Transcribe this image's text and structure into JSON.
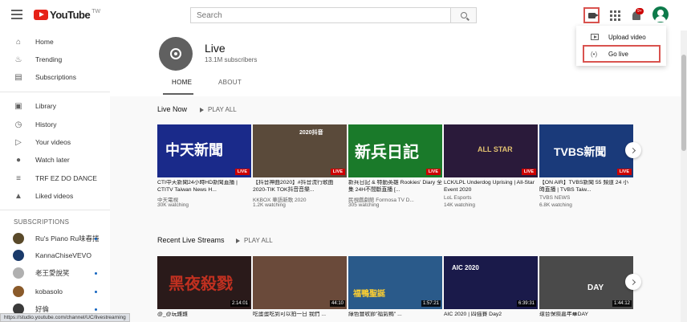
{
  "header": {
    "logo_text": "YouTube",
    "logo_region": "TW",
    "search_placeholder": "Search"
  },
  "notifications": {
    "badge": "9+"
  },
  "sidebar": {
    "main_items": [
      {
        "label": "Home",
        "icon": "home-icon"
      },
      {
        "label": "Trending",
        "icon": "flame-icon"
      },
      {
        "label": "Subscriptions",
        "icon": "subscriptions-icon"
      }
    ],
    "library_items": [
      {
        "label": "Library",
        "icon": "library-icon"
      },
      {
        "label": "History",
        "icon": "history-icon"
      },
      {
        "label": "Your videos",
        "icon": "your-videos-icon"
      },
      {
        "label": "Watch later",
        "icon": "clock-icon"
      },
      {
        "label": "TRF EZ DO DANCE",
        "icon": "playlist-icon"
      },
      {
        "label": "Liked videos",
        "icon": "thumbs-up-icon"
      }
    ],
    "subscriptions_header": "SUBSCRIPTIONS",
    "subscriptions": [
      {
        "name": "Ru's Piano Ru味春捲",
        "color": "#5a4a2a",
        "dot": true
      },
      {
        "name": "KannaChiseVEVO",
        "color": "#1a3a6a",
        "dot": false
      },
      {
        "name": "老王愛說笑",
        "color": "#b0b0b0",
        "dot": true
      },
      {
        "name": "kobasolo",
        "color": "#8a5a2a",
        "dot": true
      },
      {
        "name": "好倫",
        "color": "#3a3a3a",
        "dot": true
      }
    ]
  },
  "channel": {
    "name": "Live",
    "subscribers": "13.1M subscribers",
    "tabs": [
      "HOME",
      "ABOUT"
    ]
  },
  "sections": {
    "live_now": {
      "title": "Live Now",
      "play_all": "PLAY ALL",
      "cards": [
        {
          "title": "CTI中天新聞24小時HD新聞直播 | CTITV Taiwan News H...",
          "channel": "中天電視",
          "meta": "30K watching",
          "tag": "LIVE",
          "bg": "#1a2a8a",
          "thumb_text": "中天新聞",
          "thumb_color": "#ffffff"
        },
        {
          "title": "【抖音神曲2020】#抖音流行歌曲 2020-TIK TOK抖音音樂...",
          "channel": "KKBOX 華語新歌 2020",
          "meta": "1.2K watching",
          "tag": "LIVE",
          "bg": "#5a4a3a",
          "thumb_text": "2020抖音",
          "thumb_color": "#ffffff"
        },
        {
          "title": "新兵日記 & 特勤英雄 Rookies' Diary 全集 24H不間斷直播 [...",
          "channel": "民視戲劇館 Formosa TV D...",
          "meta": "305 watching",
          "tag": "LIVE",
          "bg": "#1a7a2a",
          "thumb_text": "新兵日記",
          "thumb_color": "#ffffff"
        },
        {
          "title": "LCK/LPL Underdog Uprising | All-Star Event 2020",
          "channel": "LoL Esports",
          "meta": "14K watching",
          "tag": "LIVE",
          "bg": "#2a1a3a",
          "thumb_text": "ALL STAR",
          "thumb_color": "#e0c070"
        },
        {
          "title": "【ON AIR】TVBS新聞 55 頻道 24 小時直播 | TVBS Taiw...",
          "channel": "TVBS NEWS",
          "meta": "6.8K watching",
          "tag": "LIVE",
          "bg": "#1a3a7a",
          "thumb_text": "TVBS新聞",
          "thumb_color": "#ffffff"
        }
      ]
    },
    "recent_live": {
      "title": "Recent Live Streams",
      "play_all": "PLAY ALL",
      "cards": [
        {
          "title": "@_@玩雞雞",
          "duration": "2:14:01",
          "bg": "#2a1a1a",
          "thumb_text": "黑夜殺戮",
          "thumb_color": "#c03020"
        },
        {
          "title": "吃蛋蛋吃到可以拍一日 我們 ...",
          "duration": "44:10",
          "bg": "#6a4a3a",
          "thumb_text": "",
          "thumb_color": "#ffffff"
        },
        {
          "title": "綠色豐收節\"福氣鴨\" ...",
          "duration": "1:57:21",
          "bg": "#2a5a8a",
          "thumb_text": "福鴨聖誕",
          "thumb_color": "#ffd030"
        },
        {
          "title": "AIC 2020 | 四強賽 Day2",
          "duration": "6:39:31",
          "bg": "#1a1a4a",
          "thumb_text": "AIC 2020",
          "thumb_color": "#ffffff"
        },
        {
          "title": "環台保險嘉年華DAY",
          "duration": "1:44:12",
          "bg": "#4a4a4a",
          "thumb_text": "DAY",
          "thumb_color": "#ffffff"
        }
      ]
    }
  },
  "dropdown": {
    "upload": "Upload video",
    "golive": "Go live"
  },
  "status_url": "https://studio.youtube.com/channel/UC/livestreaming"
}
